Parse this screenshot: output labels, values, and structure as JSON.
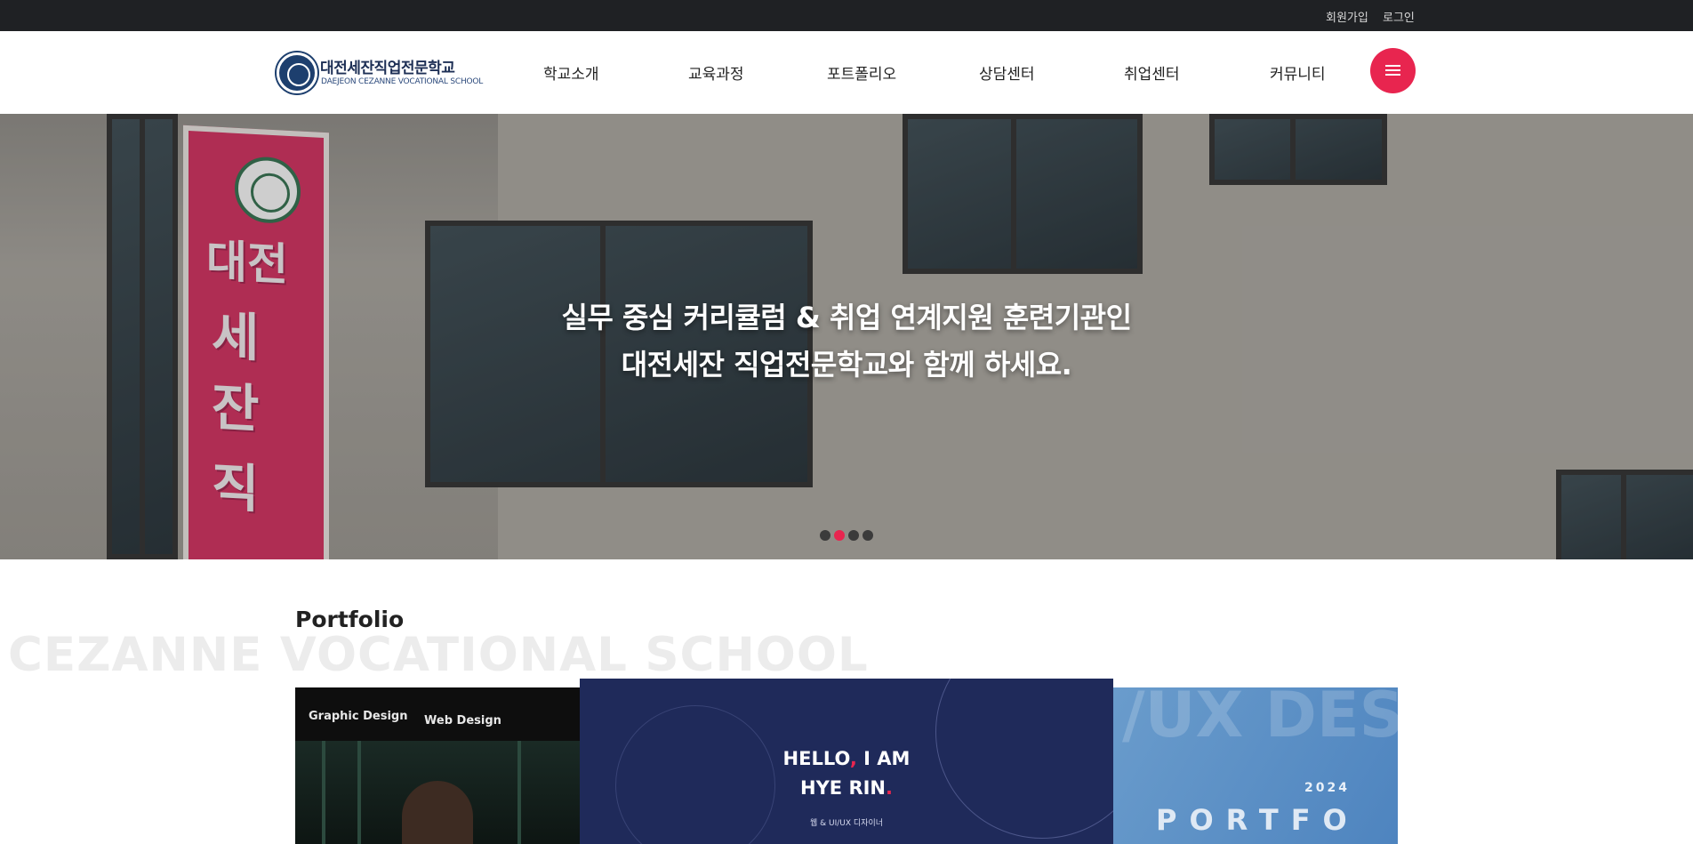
{
  "topbar": {
    "signup": "회원가입",
    "login": "로그인"
  },
  "header": {
    "logo": {
      "name_ko": "대전세잔직업전문학교",
      "name_en": "DAEJEON CEZANNE VOCATIONAL SCHOOL"
    },
    "nav": [
      {
        "label": "학교소개"
      },
      {
        "label": "교육과정"
      },
      {
        "label": "포트폴리오"
      },
      {
        "label": "상담센터"
      },
      {
        "label": "취업센터"
      },
      {
        "label": "커뮤니티"
      }
    ],
    "menu_icon": "hamburger-icon",
    "accent_color": "#e8254f"
  },
  "hero": {
    "line1": "실무 중심 커리큘럼 & 취업 연계지원 훈련기관인",
    "line2": "대전세잔 직업전문학교와 함께 하세요.",
    "sign_chars": [
      "대전",
      "세",
      "잔",
      "직"
    ],
    "slides_total": 4,
    "active_slide": 2
  },
  "portfolio": {
    "title": "Portfolio",
    "watermark": "CEZANNE VOCATIONAL SCHOOL",
    "cards": {
      "left": {
        "tag1": "Graphic Design",
        "tag2": "Web Design"
      },
      "center": {
        "hello_line1_a": "HELLO",
        "hello_line1_b": ",",
        "hello_line1_c": " I AM",
        "hello_line2_a": "HYE RIN",
        "hello_line2_b": ".",
        "subtitle": "웹 & UI/UX 디자이너"
      },
      "right": {
        "year": "2024",
        "word": "PORTFO",
        "bg_text": "/UX DES"
      }
    }
  }
}
